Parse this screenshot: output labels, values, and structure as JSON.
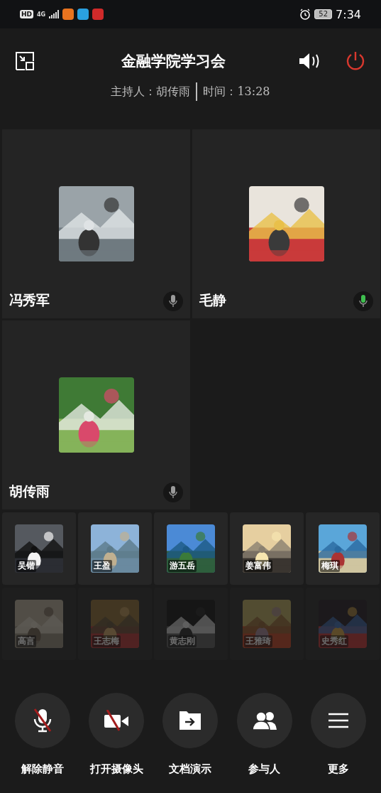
{
  "status_bar": {
    "hd": "HD",
    "network": "4G",
    "battery": "52",
    "time": "7:34"
  },
  "header": {
    "title": "金融学院学习会",
    "host": "主持人：胡传雨",
    "time": "时间：13:28"
  },
  "video_tiles": [
    {
      "name": "冯秀军",
      "speaking": false
    },
    {
      "name": "毛静",
      "speaking": true
    },
    {
      "name": "胡传雨",
      "speaking": false
    }
  ],
  "thumbnails": [
    {
      "name": "吴锴",
      "faded": false
    },
    {
      "name": "王盈",
      "faded": false
    },
    {
      "name": "游五岳",
      "faded": false
    },
    {
      "name": "姜富伟",
      "faded": false
    },
    {
      "name": "梅琪",
      "faded": false
    },
    {
      "name": "高言",
      "faded": true
    },
    {
      "name": "王志梅",
      "faded": true
    },
    {
      "name": "黄志刚",
      "faded": true
    },
    {
      "name": "王雅琦",
      "faded": true
    },
    {
      "name": "史秀红",
      "faded": true
    }
  ],
  "controls": [
    {
      "kind": "mic-off",
      "label": "解除静音"
    },
    {
      "kind": "camera-off",
      "label": "打开摄像头"
    },
    {
      "kind": "share",
      "label": "文档演示"
    },
    {
      "kind": "people",
      "label": "参与人"
    },
    {
      "kind": "menu",
      "label": "更多"
    }
  ]
}
